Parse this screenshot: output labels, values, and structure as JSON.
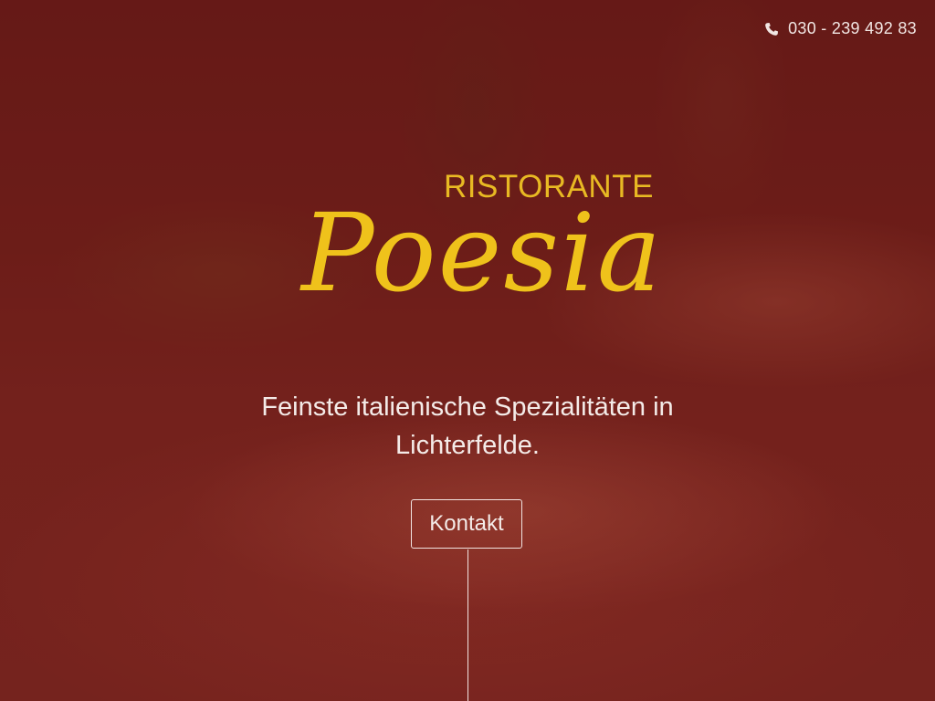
{
  "header": {
    "phone_icon": "phone-icon",
    "phone_number": "030 - 239 492 83"
  },
  "hero": {
    "label_small": "RISTORANTE",
    "name": "Poesia",
    "tagline_line1": "Feinste italienische Spezialitäten in",
    "tagline_line2": "Lichterfelde.",
    "cta_label": "Kontakt"
  },
  "colors": {
    "overlay": "#6b1c18",
    "accent_gold": "#efc21b",
    "text_light": "#f4ebe8"
  }
}
